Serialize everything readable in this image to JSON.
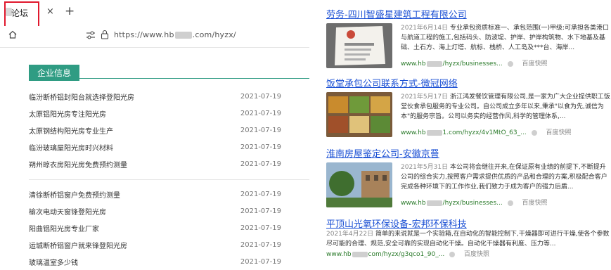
{
  "browser": {
    "tab_title": "论坛",
    "tab_close": "×",
    "new_tab": "+",
    "url_prefix": "https://www.hb",
    "url_suffix": ".com/hyzx/"
  },
  "page": {
    "section_title": "企业信息",
    "group1": [
      {
        "title": "临汾断桥铝封阳台就选择登阳光房",
        "date": "2021-07-19"
      },
      {
        "title": "太原铝阳光房专注阳光房",
        "date": "2021-07-19"
      },
      {
        "title": "太原钢结构阳光房专业生产",
        "date": "2021-07-19"
      },
      {
        "title": "临汾玻璃屋阳光房时兴材料",
        "date": "2021-07-19"
      },
      {
        "title": "朔州晾衣房阳光房免费预约测量",
        "date": "2021-07-19"
      }
    ],
    "group2": [
      {
        "title": "清徐断桥铝窗户免费预约测量",
        "date": "2021-07-19"
      },
      {
        "title": "榆次电动天窗锋登阳光房",
        "date": "2021-07-19"
      },
      {
        "title": "阳曲铝阳光房专业厂家",
        "date": "2021-07-19"
      },
      {
        "title": "运城断桥铝窗户就来锋登阳光房",
        "date": "2021-07-19"
      },
      {
        "title": "玻璃温室多少钱",
        "date": "2021-07-19"
      }
    ]
  },
  "results": [
    {
      "title": "劳务-四川智盛星建筑工程有限公司",
      "date": "2021年6月14日",
      "snippet": "专业承包资质标准一、承包范围(一)甲级:可承担各类港口与航道工程的施工,包括码头、防波堤、护岸、护岸构筑物、水下地基及基础、土石方、海上灯塔、航标、栈桥、人工岛及***台、海岸...",
      "url_prefix": "www.hb",
      "url_suffix": "/hyzx/businesses...",
      "snapshot": "百度快照"
    },
    {
      "title": "饭堂承包公司联系方式-微冠网络",
      "date": "2021年5月17日",
      "snippet": "浙江鸿发餐饮管理有限公司,是一家为广大企业提供职工饭堂伙食承包服务的专业公司。自公司成立多年以来,秉承\"以食为先,诚信为本\"的服务宗旨。公司以务实的经营作风,科学的管理体系,...",
      "url_prefix": "www.hb",
      "url_suffix": "1.com/hyzx/4v1MtO_63_...",
      "snapshot": "百度快照"
    },
    {
      "title": "淮南房屋鉴定公司-安徽京罾",
      "date": "2021年5月31日",
      "snippet": "本公司将会继往开来,在保证原有业绩的前提下,不断提升公司的综合实力,按照客户需求提供优质的产品和合理的方案,积极配合客户完成各种环境下的工作作业,我们致力于成为客户的强力后盾...",
      "url_prefix": "www.hb",
      "url_suffix": "/hyzx/businesses...",
      "snapshot": "百度快照"
    },
    {
      "title": "平顶山光氧环保设备-宏邦环保科技",
      "date": "2021年4月22日",
      "snippet": "简单的来说就是一个实验箱,在自动化的智能控制下,干燥器即可进行干燥,使各个参数尽可能的合理、规范,安全可靠的实现自动化干燥。自动化干燥器有利度、压力等...",
      "url_prefix": "www.hb",
      "url_suffix": "com/hyzx/g3qco1_90_...",
      "snapshot": "百度快照"
    }
  ]
}
